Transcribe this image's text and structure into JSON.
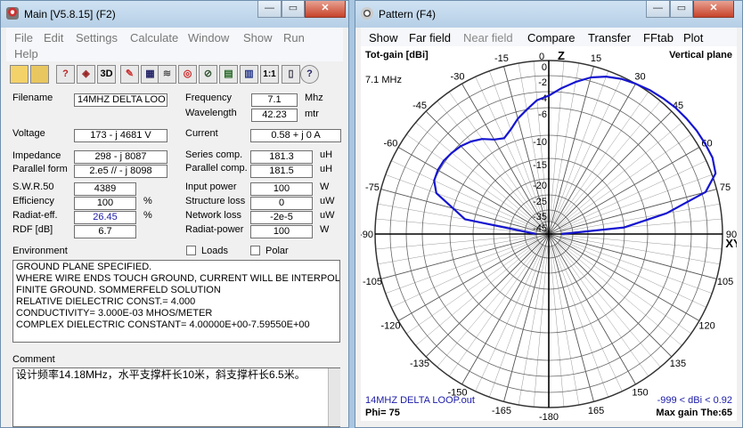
{
  "main": {
    "title": "Main [V5.8.15]  (F2)",
    "menu": [
      "File",
      "Edit",
      "Settings",
      "Calculate",
      "Window",
      "Show",
      "Run",
      "Help"
    ],
    "toolbar_icons": [
      "open-folder-icon",
      "save-icon",
      "help-bulb-icon",
      "cube-icon",
      "3d-icon",
      "edit-icon",
      "grid-icon",
      "pattern-icon",
      "target-icon",
      "chart-icon",
      "table-icon",
      "monitor-icon",
      "scale-icon",
      "book-icon",
      "help-icon"
    ],
    "toolbar_3d_label": "3D",
    "toolbar_scale_label": "1:1",
    "filename_label": "Filename",
    "filename_value": "14MHZ DELTA LOO",
    "frequency_label": "Frequency",
    "frequency_value": "7.1",
    "frequency_unit": "Mhz",
    "wavelength_label": "Wavelength",
    "wavelength_value": "42.23",
    "wavelength_unit": "mtr",
    "voltage_label": "Voltage",
    "voltage_value": "173 - j 4681 V",
    "current_label": "Current",
    "current_value": "0.58 + j 0 A",
    "impedance_label": "Impedance",
    "impedance_value": "298 - j 8087",
    "parallel_form_label": "Parallel form",
    "parallel_form_value": "2.e5 // - j 8098",
    "series_comp_label": "Series comp.",
    "series_comp_value": "181.3",
    "series_comp_unit": "uH",
    "parallel_comp_label": "Parallel comp.",
    "parallel_comp_value": "181.5",
    "parallel_comp_unit": "uH",
    "swr_label": "S.W.R.50",
    "swr_value": "4389",
    "input_power_label": "Input power",
    "input_power_value": "100",
    "input_power_unit": "W",
    "efficiency_label": "Efficiency",
    "efficiency_value": "100",
    "efficiency_unit": "%",
    "structure_loss_label": "Structure loss",
    "structure_loss_value": "0",
    "structure_loss_unit": "uW",
    "radiat_eff_label": "Radiat-eff.",
    "radiat_eff_value": "26.45",
    "radiat_eff_unit": "%",
    "network_loss_label": "Network loss",
    "network_loss_value": "-2e-5",
    "network_loss_unit": "uW",
    "rdf_label": "RDF [dB]",
    "rdf_value": "6.7",
    "radiat_power_label": "Radiat-power",
    "radiat_power_value": "100",
    "radiat_power_unit": "W",
    "environment_label": "Environment",
    "loads_label": "Loads",
    "polar_label": "Polar",
    "environment_lines": [
      "GROUND PLANE SPECIFIED.",
      "WHERE WIRE ENDS TOUCH GROUND, CURRENT WILL BE INTERPOLATED",
      "FINITE GROUND.  SOMMERFELD SOLUTION",
      "RELATIVE DIELECTRIC CONST.=  4.000",
      "CONDUCTIVITY= 3.000E-03 MHOS/METER",
      "COMPLEX DIELECTRIC CONSTANT= 4.00000E+00-7.59550E+00"
    ],
    "comment_label": "Comment",
    "comment_value": "设计频率14.18MHz，水平支撑杆长10米，斜支撑杆长6.5米。"
  },
  "pattern": {
    "title": "Pattern    (F4)",
    "menu": [
      {
        "label": "Show",
        "enabled": true
      },
      {
        "label": "Far field",
        "enabled": true
      },
      {
        "label": "Near field",
        "enabled": false
      },
      {
        "label": "Compare",
        "enabled": true
      },
      {
        "label": "Transfer",
        "enabled": true
      },
      {
        "label": "FFtab",
        "enabled": true
      },
      {
        "label": "Plot",
        "enabled": true
      }
    ],
    "tot_gain_label": "Tot-gain [dBi]",
    "plane_label": "Vertical plane",
    "freq_label": "7.1 MHz",
    "z_label": "Z",
    "xy_label": "XY",
    "file_label": "14MHZ DELTA LOOP.out",
    "gain_range_label": "-999 < dBi < 0.92",
    "phi_label": "Phi= 75",
    "max_gain_label": "Max gain The:65",
    "angle_labels": [
      "0",
      "-15",
      "15",
      "-30",
      "30",
      "-45",
      "45",
      "-60",
      "60",
      "-75",
      "75",
      "-90",
      "90",
      "-105",
      "105",
      "-120",
      "120",
      "-135",
      "135",
      "-150",
      "150",
      "-165",
      "165",
      "-180"
    ],
    "ring_labels": [
      "0",
      "-2",
      "-4",
      "-6",
      "-10",
      "-15",
      "-20",
      "-25",
      "-35",
      "-45"
    ],
    "colors": {
      "trace": "#1515d0",
      "ring_text": "#000000",
      "info_blue": "#1a1aa8"
    }
  },
  "chart_data": {
    "type": "polar",
    "title": "Tot-gain [dBi]",
    "angle_unit": "degrees (zenith 0, horizon ±90)",
    "ring_ticks_dBi": [
      0,
      -2,
      -4,
      -6,
      -10,
      -15,
      -20,
      -25,
      -35,
      -45
    ],
    "theta": [
      -90,
      -80,
      -75,
      -70,
      -65,
      -60,
      -55,
      -50,
      -45,
      -40,
      -35,
      -30,
      -25,
      -20,
      -15,
      -10,
      -5,
      0,
      5,
      10,
      15,
      20,
      25,
      30,
      35,
      40,
      45,
      50,
      55,
      60,
      65,
      70,
      75,
      80,
      85,
      90
    ],
    "gain_dbi": [
      -45,
      -13,
      -10,
      -7,
      -6,
      -5.8,
      -5.8,
      -6,
      -6.3,
      -6.8,
      -7.5,
      -8.5,
      -9,
      -8.2,
      -7,
      -6,
      -5,
      -4.5,
      -3.5,
      -2.5,
      -1.5,
      -0.8,
      -0.3,
      0,
      0.3,
      0.5,
      0.7,
      0.8,
      0.9,
      0.92,
      0.92,
      0.5,
      -1.5,
      -7,
      -15,
      -45
    ],
    "max_gain_dbi": 0.92,
    "phi": 75
  }
}
